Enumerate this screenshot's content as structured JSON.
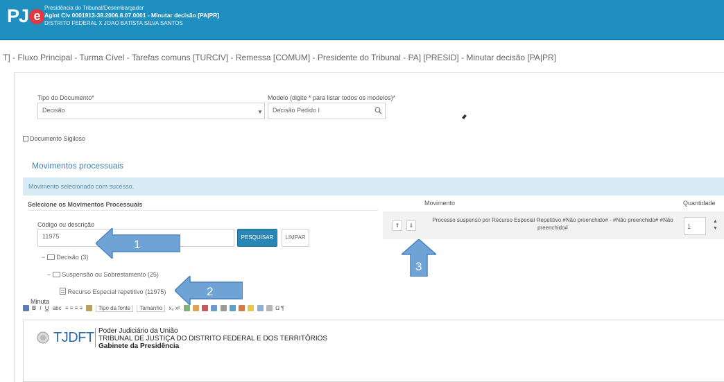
{
  "header": {
    "logo_text": "PJ",
    "logo_e": "e",
    "line1": "Presidência do Tribunal/Desembargador",
    "line2": "AgInt Civ 0001913-38.2006.8.07.0001 - Minutar decisão [PA|PR]",
    "line3": "DISTRITO FEDERAL X JOAO BATISTA SILVA SANTOS"
  },
  "breadcrumb": "T] - Fluxo Principal - Turma Cível - Tarefas comuns [TURCIV] - Remessa [COMUM] - Presidente do Tribunal - PA] [PRESID] - Minutar decisão [PA|PR]",
  "form": {
    "doc_type_label": "Tipo do Documento*",
    "doc_type_value": "Decisão",
    "model_label": "Modelo (digite * para listar todos os modelos)*",
    "model_value": "Decisão Pedido I",
    "sigiloso_label": "Documento Sigiloso"
  },
  "movimentos": {
    "title": "Movimentos processuais",
    "alert": "Movimento selecionado com sucesso.",
    "select_heading": "Selecione os Movimentos Processuais",
    "search_label": "Código ou descrição",
    "search_value": "11975",
    "search_button": "PESQUISAR",
    "clear_button": "LIMPAR",
    "tree": [
      "Decisão (3)",
      "Suspensão ou Sobrestamento (25)",
      "Recurso Especial repetitivo (11975)"
    ],
    "col_movimento": "Movimento",
    "col_quantidade": "Quantidade",
    "row_text": "Processo suspenso por Recurso Especial Repetitivo #Não preenchido# - #Não preenchido# #Não preenchido#",
    "quantity": "1"
  },
  "minuta_label": "Minuta",
  "toolbar": {
    "font_family": "Tipo da fonte",
    "font_size": "Tamanho"
  },
  "letterhead": {
    "logo": "TJDFT",
    "line1": "Poder Judiciário da União",
    "line2": "TRIBUNAL DE JUSTIÇA DO DISTRITO FEDERAL E DOS TERRITÓRIOS",
    "line3": "Gabinete da Presidência"
  },
  "callouts": [
    "1",
    "2",
    "3"
  ],
  "colors": {
    "header": "#1f8fbf",
    "alert": "#d8ecf5",
    "arrow": "#6fa3d6",
    "primary_button": "#2a86b4"
  }
}
